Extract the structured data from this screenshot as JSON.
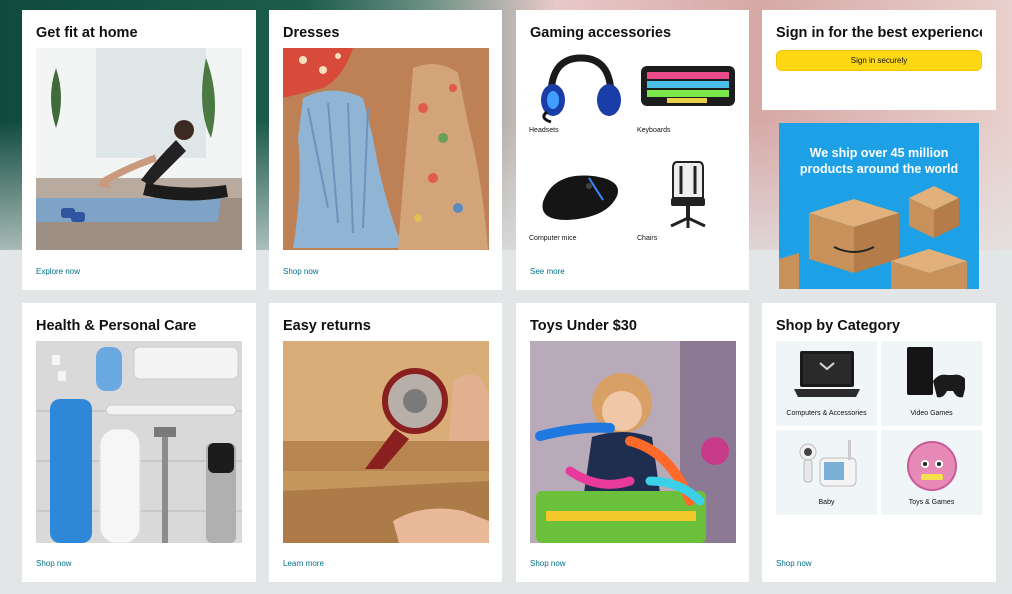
{
  "cards": {
    "fit": {
      "title": "Get fit at home",
      "link": "Explore now"
    },
    "dresses": {
      "title": "Dresses",
      "link": "Shop now"
    },
    "gaming": {
      "title": "Gaming accessories",
      "link": "See more",
      "items": [
        {
          "label": "Headsets",
          "icon": "headset-icon"
        },
        {
          "label": "Keyboards",
          "icon": "keyboard-icon"
        },
        {
          "label": "Computer mice",
          "icon": "mouse-icon"
        },
        {
          "label": "Chairs",
          "icon": "chair-icon"
        }
      ]
    },
    "signin": {
      "title": "Sign in for the best experience",
      "button": "Sign in securely"
    },
    "health": {
      "title": "Health & Personal Care",
      "link": "Shop now"
    },
    "returns": {
      "title": "Easy returns",
      "link": "Learn more"
    },
    "toys": {
      "title": "Toys Under $30",
      "link": "Shop now"
    },
    "category": {
      "title": "Shop by Category",
      "link": "Shop now",
      "items": [
        {
          "label": "Computers & Accessories",
          "icon": "laptop-icon"
        },
        {
          "label": "Video Games",
          "icon": "game-console-icon"
        },
        {
          "label": "Baby",
          "icon": "baby-monitor-icon"
        },
        {
          "label": "Toys & Games",
          "icon": "toy-ball-icon"
        }
      ]
    }
  },
  "ad": {
    "text": "We ship over 45 million products around the world"
  },
  "colors": {
    "link": "#007185",
    "button": "#ffd814",
    "ad_bg": "#1ea0e6"
  }
}
